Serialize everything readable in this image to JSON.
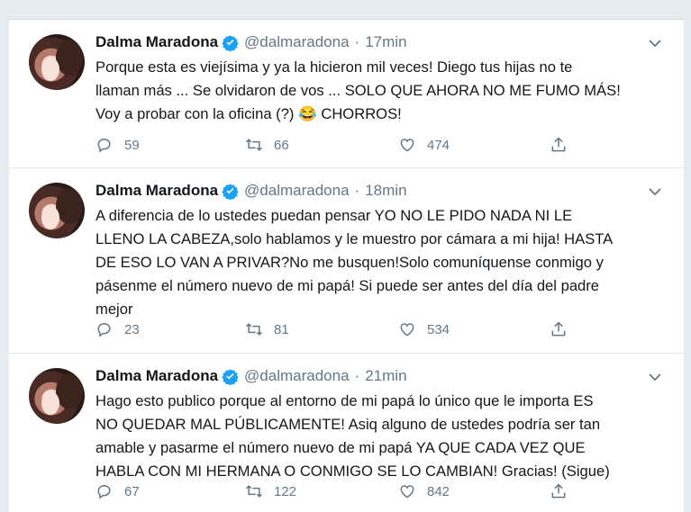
{
  "tweets": [
    {
      "author_name": "Dalma Maradona",
      "handle": "@dalmaradona",
      "time": "17min",
      "text": "Porque esta es viejísima y ya la hicieron mil veces! Diego tus hijas no te\nllaman más ... Se olvidaron de vos ... SOLO QUE AHORA NO ME FUMO MÁS!\nVoy a probar con la oficina (?) 😂 CHORROS!",
      "replies": "59",
      "retweets": "66",
      "likes": "474"
    },
    {
      "author_name": "Dalma Maradona",
      "handle": "@dalmaradona",
      "time": "18min",
      "text": "A diferencia de lo ustedes puedan pensar YO NO LE PIDO NADA NI LE\nLLENO LA CABEZA,solo hablamos y le muestro por cámara a mi hija! HASTA\nDE ESO LO VAN A PRIVAR?No me busquen!Solo comuníquense conmigo y\npásenme el número nuevo de mi papá! Si puede ser antes del día del padre\nmejor",
      "replies": "23",
      "retweets": "81",
      "likes": "534"
    },
    {
      "author_name": "Dalma Maradona",
      "handle": "@dalmaradona",
      "time": "21min",
      "text": "Hago esto publico porque al entorno de mi papá lo único que le importa ES\nNO QUEDAR MAL PÚBLICAMENTE! Asiq alguno de ustedes podría ser tan\namable y pasarme el número nuevo de mi papá YA QUE CADA VEZ QUE\nHABLA CON MI HERMANA O CONMIGO SE LO CAMBIAN! Gracias! (Sigue)",
      "replies": "67",
      "retweets": "122",
      "likes": "842"
    }
  ],
  "separator": "·",
  "colors": {
    "verified": "#1da1f2",
    "secondary_text": "#657786",
    "divider": "#e1e8ed"
  },
  "icons": [
    "verified-badge-icon",
    "chevron-down-icon",
    "reply-icon",
    "retweet-icon",
    "like-icon",
    "share-icon"
  ]
}
